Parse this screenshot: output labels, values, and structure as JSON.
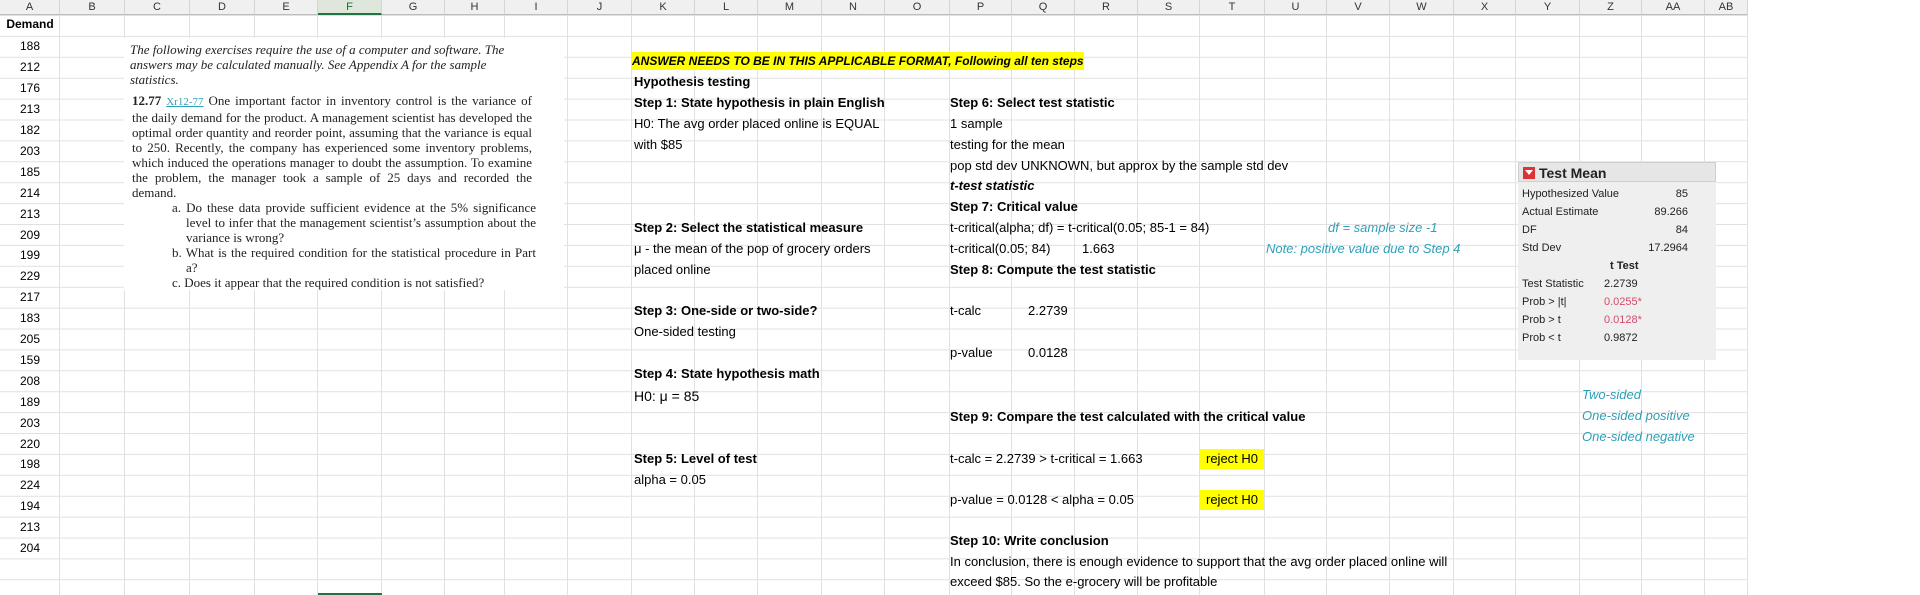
{
  "columns": [
    "A",
    "B",
    "C",
    "D",
    "E",
    "F",
    "G",
    "H",
    "I",
    "J",
    "K",
    "L",
    "M",
    "N",
    "O",
    "P",
    "Q",
    "R",
    "S",
    "T",
    "U",
    "V",
    "W",
    "X",
    "Y",
    "Z",
    "AA",
    "AB"
  ],
  "selected_column": "F",
  "col_a_header": "Demand",
  "demand_values": [
    "188",
    "212",
    "176",
    "213",
    "182",
    "203",
    "185",
    "214",
    "213",
    "209",
    "199",
    "229",
    "217",
    "183",
    "205",
    "159",
    "208",
    "189",
    "203",
    "220",
    "198",
    "224",
    "194",
    "213",
    "204"
  ],
  "textbook": {
    "intro": "The following exercises require the use of a computer and software. The answers may be calculated manually. See Appendix A for the sample statistics.",
    "problem_number": "12.77",
    "xr_label": "Xr12-77",
    "problem_text": "One important factor in inventory control is the variance of the daily demand for the product. A management scientist has developed the optimal order quantity and reorder point, assuming that the variance is equal to 250. Recently, the company has experienced some inventory problems, which induced the operations manager to doubt the assumption. To examine the problem, the manager took a sample of 25 days and recorded the demand.",
    "question_a": "a. Do these data provide sufficient evidence at the 5% significance level to infer that the management scientist’s assumption about the variance is wrong?",
    "question_b": "b. What is the required condition for the statistical procedure in Part a?",
    "question_c": "c. Does it appear that the required condition is not satisfied?"
  },
  "steps": {
    "banner": "ANSWER NEEDS TO BE IN THIS APPLICABLE FORMAT, Following all ten steps",
    "hyp_testing": "Hypothesis testing",
    "step1": "Step 1: State hypothesis in plain English",
    "step1_l1": "H0: The avg order placed online is EQUAL",
    "step1_l2": "with $85",
    "step2": "Step 2: Select the statistical measure",
    "step2_l1": "μ - the mean of the pop of grocery orders",
    "step2_l2": "placed online",
    "step3": "Step 3: One-side or two-side?",
    "step3_l1": "One-sided testing",
    "step4": "Step 4: State hypothesis math",
    "step4_l1": "H0: μ = 85",
    "step5": "Step 5: Level of test",
    "step5_l1": "alpha = 0.05",
    "step6": "Step 6: Select test statistic",
    "step6_l1": "1 sample",
    "step6_l2": "testing for the mean",
    "step6_l3": "pop std dev UNKNOWN, but approx by the sample std dev",
    "step6_l4": "t-test statistic",
    "step7": "Step 7: Critical value",
    "step7_l1": "t-critical(alpha; df) = t-critical(0.05; 85-1 = 84)",
    "step7_l2": "t-critical(0.05; 84)",
    "step7_l2_val": "1.663",
    "step7_note1": "df = sample size -1",
    "step7_note2": "Note: positive value due to Step 4",
    "step8": "Step 8: Compute the test statistic",
    "tcalc_label": "t-calc",
    "tcalc_val": "2.2739",
    "pvalue_label": "p-value",
    "pvalue_val": "0.0128",
    "step9": "Step 9: Compare the test calculated with the critical value",
    "step9_l1": "t-calc = 2.2739 > t-critical = 1.663",
    "step9_l1_result": "reject H0",
    "step9_l2": "p-value = 0.0128 < alpha = 0.05",
    "step9_l2_result": "reject H0",
    "step10": "Step 10: Write conclusion",
    "step10_l1": "In conclusion, there is enough evidence to support that the avg order placed online will",
    "step10_l2": "exceed $85.  So the e-grocery will be profitable",
    "legend_two": "Two-sided",
    "legend_pos": "One-sided positive",
    "legend_neg": "One-sided negative"
  },
  "jmp": {
    "title": "Test Mean",
    "hyp_label": "Hypothesized Value",
    "hyp_val": "85",
    "actual_label": "Actual Estimate",
    "actual_val": "89.266",
    "df_label": "DF",
    "df_val": "84",
    "sd_label": "Std Dev",
    "sd_val": "17.2964",
    "ttest_label": "t Test",
    "stat_label": "Test Statistic",
    "stat_val": "2.2739",
    "p_abs_label": "Prob > |t|",
    "p_abs_val": "0.0255*",
    "p_gt_label": "Prob > t",
    "p_gt_val": "0.0128*",
    "p_lt_label": "Prob < t",
    "p_lt_val": "0.9872"
  },
  "colors": {
    "highlight": "#ffff00",
    "teal_note": "#2e9fb8",
    "significant": "#d64b6a",
    "excel_green": "#217346"
  }
}
